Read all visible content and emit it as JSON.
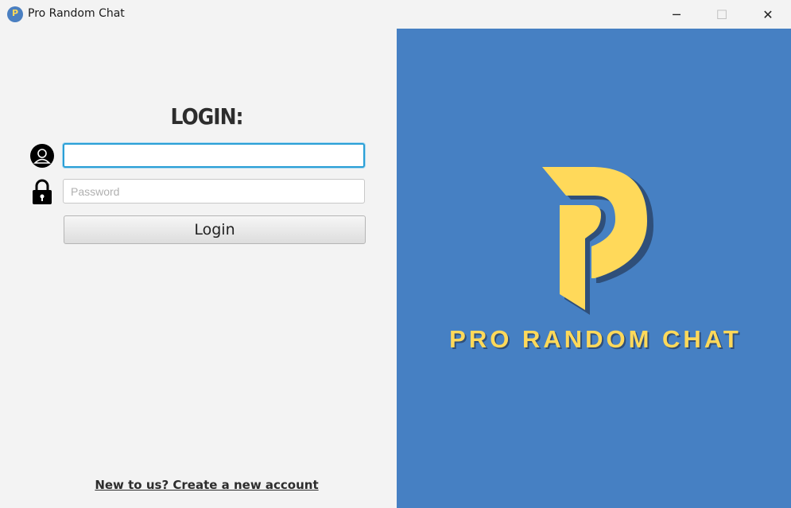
{
  "window": {
    "title": "Pro Random Chat",
    "icon": "app-logo-icon",
    "icon_letter": "P"
  },
  "controls": {
    "minimize": "─",
    "maximize": "☐",
    "close": "✕"
  },
  "login": {
    "heading": "LOGIN:",
    "username_value": "",
    "username_placeholder": "",
    "password_placeholder": "Password",
    "button_label": "Login",
    "signup_link": "New to us? Create a new account"
  },
  "brand": {
    "name": "PRO RANDOM CHAT",
    "logo_color": "#ffd95a",
    "panel_color": "#4680c3"
  },
  "icons": {
    "user": "user-icon",
    "lock": "lock-icon"
  }
}
